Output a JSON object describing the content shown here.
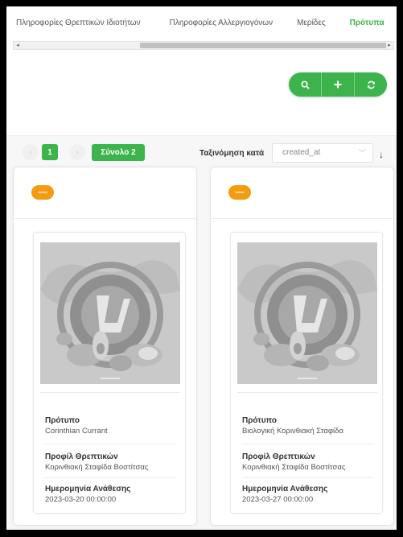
{
  "tabs": [
    {
      "label": "Πληροφορίες Θρεπτικών Ιδιοτήτων",
      "active": false
    },
    {
      "label": "Πληροφορίες Αλλεργιογόνων",
      "active": false
    },
    {
      "label": "Μερίδες",
      "active": false
    },
    {
      "label": "Πρότυπα",
      "active": true
    }
  ],
  "actions": {
    "search_icon": "search-icon",
    "add_icon": "plus-icon",
    "refresh_icon": "refresh-icon"
  },
  "pagination": {
    "prev": "‹",
    "current_page": "1",
    "next": "›",
    "total_label": "Σύνολο 2"
  },
  "sort": {
    "label": "Ταξινόμηση κατά",
    "selected": "created_at",
    "direction_icon": "arrow-down-icon"
  },
  "cards": [
    {
      "collapse_label": "—",
      "fields": [
        {
          "label": "Πρότυπο",
          "value": "Corinthian Currant"
        },
        {
          "label": "Προφίλ Θρεπτικών",
          "value": "Κορινθιακή Σταφίδα Βοστίτσας"
        },
        {
          "label": "Ημερομηνία Ανάθεσης",
          "value": "2023-03-20 00:00:00"
        }
      ]
    },
    {
      "collapse_label": "—",
      "fields": [
        {
          "label": "Πρότυπο",
          "value": "Βιολογική Κορινθιακή Σταφίδα"
        },
        {
          "label": "Προφίλ Θρεπτικών",
          "value": "Κορινθιακή Σταφίδα Βοστίτσας"
        },
        {
          "label": "Ημερομηνία Ανάθεσης",
          "value": "2023-03-27 00:00:00"
        }
      ]
    }
  ],
  "colors": {
    "accent_green": "#3cb44b",
    "accent_orange": "#f39c12"
  }
}
